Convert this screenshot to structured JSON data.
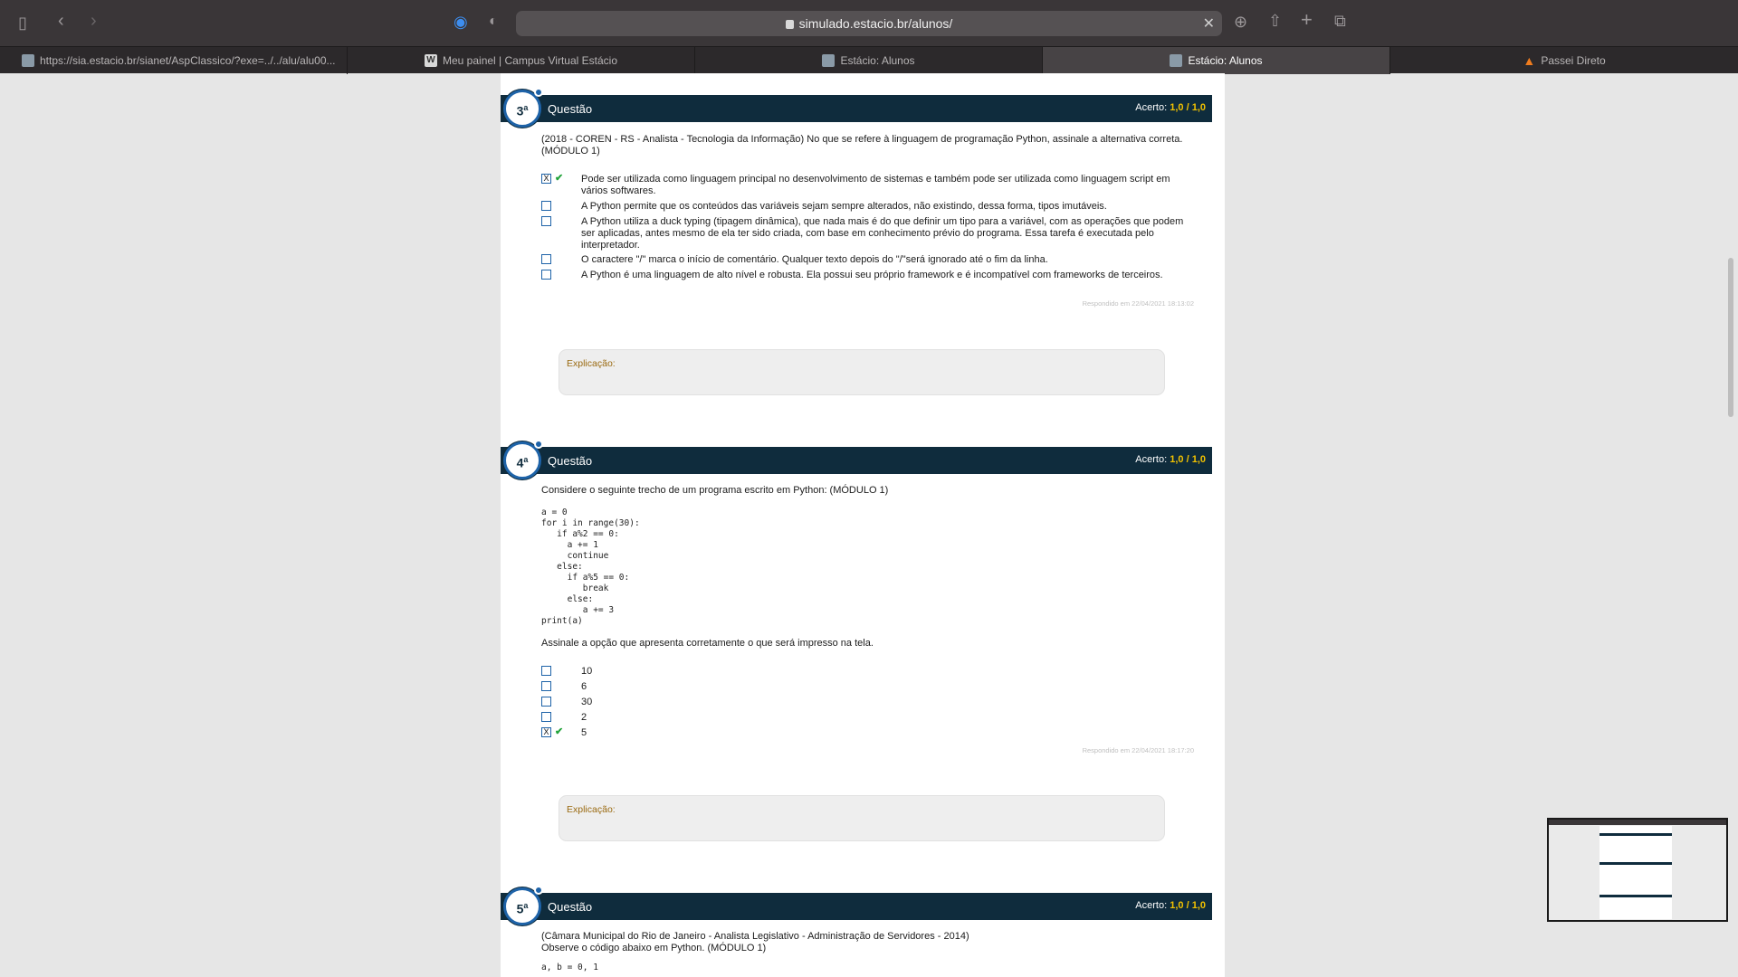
{
  "browser": {
    "url": "simulado.estacio.br/alunos/",
    "tabs": [
      {
        "label": "https://sia.estacio.br/sianet/AspClassico/?exe=../../alu/alu00..."
      },
      {
        "label": "Meu painel | Campus Virtual Estácio"
      },
      {
        "label": "Estácio: Alunos"
      },
      {
        "label": "Estácio: Alunos"
      },
      {
        "label": "Passei Direto"
      }
    ]
  },
  "questions": [
    {
      "number": "3",
      "ordinal": "a",
      "title": "Questão",
      "score_label": "Acerto:",
      "score_got": "1,0",
      "score_sep": "/",
      "score_max": "1,0",
      "statement": "(2018 - COREN - RS - Analista - Tecnologia da Informação) No que se refere à linguagem de programação Python, assinale a alternativa correta. (MÓDULO 1)",
      "options": [
        {
          "text": "Pode ser utilizada como linguagem principal no desenvolvimento de sistemas e também pode ser utilizada como linguagem script em vários softwares.",
          "selected": true,
          "correct": true
        },
        {
          "text": "A Python permite que os conteúdos das variáveis sejam sempre alterados, não existindo, dessa forma, tipos imutáveis.",
          "selected": false,
          "correct": false
        },
        {
          "text": "A Python utiliza a duck typing (tipagem dinâmica), que nada mais é do que definir um tipo para a variável, com as operações que podem ser aplicadas, antes mesmo de ela ter sido criada, com base em conhecimento prévio do programa. Essa tarefa é executada pelo interpretador.",
          "selected": false,
          "correct": false
        },
        {
          "text": "O caractere \"/\" marca o início de comentário. Qualquer texto depois do \"/\"será ignorado até o fim da linha.",
          "selected": false,
          "correct": false
        },
        {
          "text": "A Python é uma linguagem de alto nível e robusta. Ela possui seu próprio framework e é incompatível com frameworks de terceiros.",
          "selected": false,
          "correct": false
        }
      ],
      "answered": "Respondido em 22/04/2021 18:13:02",
      "explanation_label": "Explicação:"
    },
    {
      "number": "4",
      "ordinal": "a",
      "title": "Questão",
      "score_label": "Acerto:",
      "score_got": "1,0",
      "score_sep": "/",
      "score_max": "1,0",
      "statement": "Considere o seguinte trecho de um programa escrito em Python: (MÓDULO 1)",
      "code": "a = 0\nfor i in range(30):\n   if a%2 == 0:\n     a += 1\n     continue\n   else:\n     if a%5 == 0:\n        break\n     else:\n        a += 3\nprint(a)",
      "prompt": "Assinale a opção que apresenta corretamente o que será impresso na tela.",
      "options": [
        {
          "text": "10",
          "selected": false,
          "correct": false
        },
        {
          "text": "6",
          "selected": false,
          "correct": false
        },
        {
          "text": "30",
          "selected": false,
          "correct": false
        },
        {
          "text": "2",
          "selected": false,
          "correct": false
        },
        {
          "text": "5",
          "selected": true,
          "correct": true
        }
      ],
      "answered": "Respondido em 22/04/2021 18:17:20",
      "explanation_label": "Explicação:"
    },
    {
      "number": "5",
      "ordinal": "a",
      "title": "Questão",
      "score_label": "Acerto:",
      "score_got": "1,0",
      "score_sep": "/",
      "score_max": "1,0",
      "statement": "(Câmara Municipal do Rio de Janeiro - Analista Legislativo - Administração de Servidores - 2014)",
      "statement2": "Observe o código abaixo em Python. (MÓDULO 1)",
      "code": "a, b = 0, 1"
    }
  ],
  "marks": {
    "checked": "X",
    "correct": "✔"
  }
}
